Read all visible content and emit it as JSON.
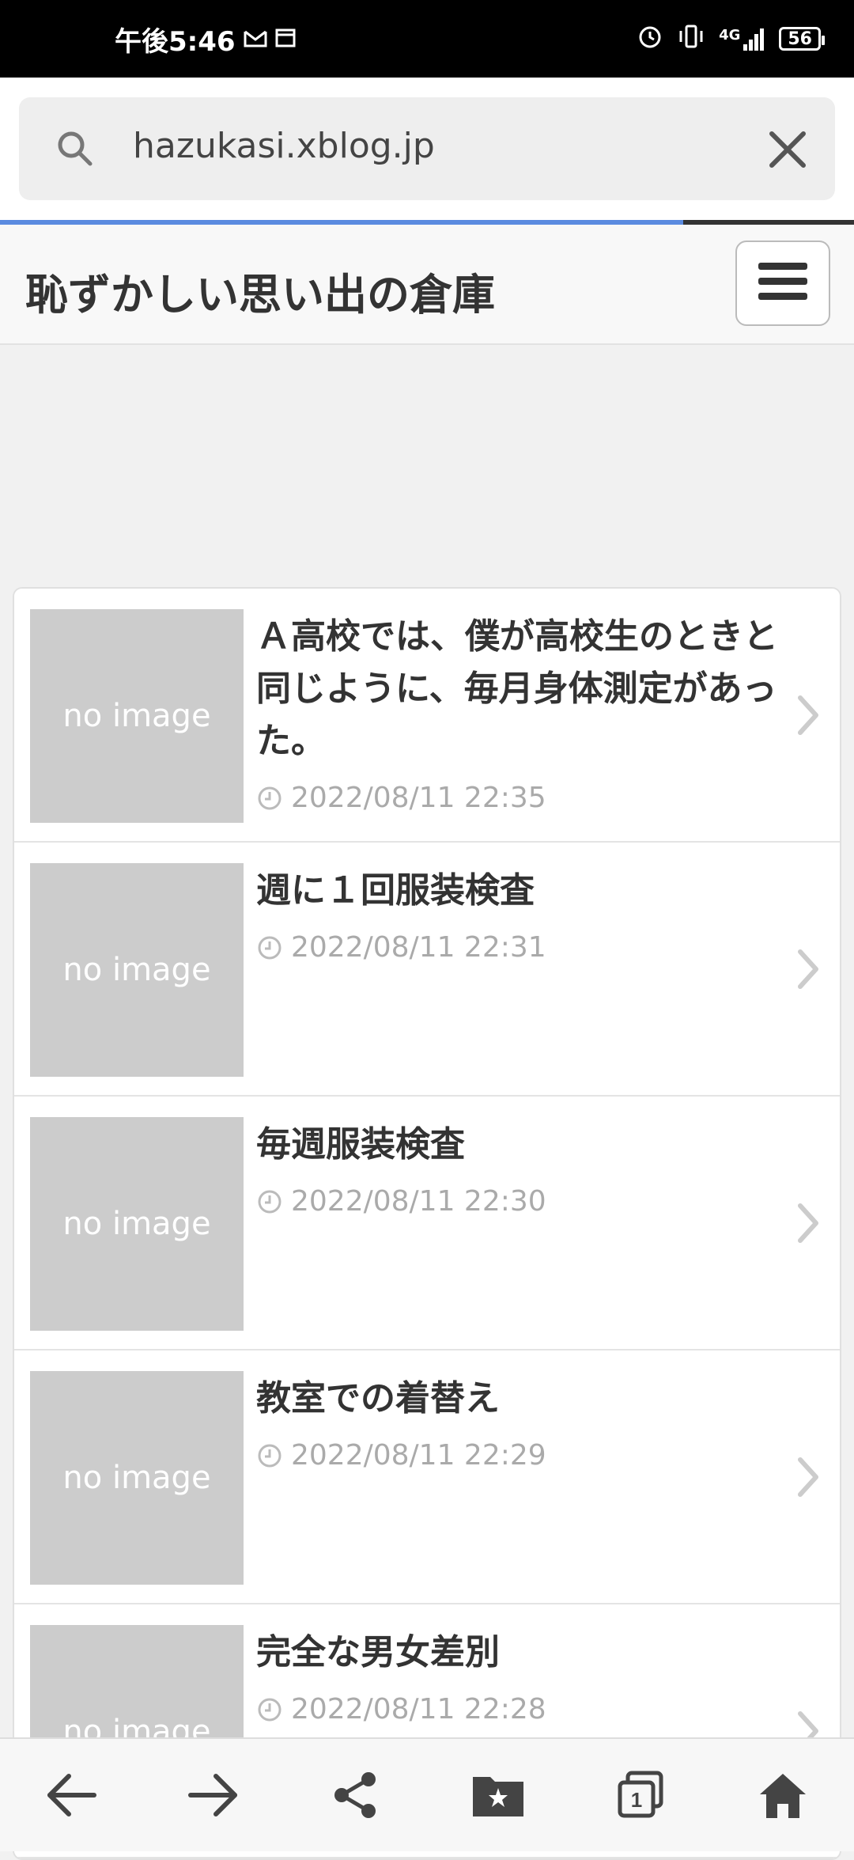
{
  "status_bar": {
    "time": "午後5:46",
    "network": "4G",
    "battery": "56"
  },
  "address_bar": {
    "url": "hazukasi.xblog.jp",
    "progress_percent": 80
  },
  "site": {
    "title": "恥ずかしい思い出の倉庫"
  },
  "articles": [
    {
      "title": "Ａ高校では、僕が高校生のときと同じように、毎月身体測定があった。",
      "date": "2022/08/11 22:35",
      "thumb": "no image"
    },
    {
      "title": "週に１回服装検査",
      "date": "2022/08/11 22:31",
      "thumb": "no image"
    },
    {
      "title": "毎週服装検査",
      "date": "2022/08/11 22:30",
      "thumb": "no image"
    },
    {
      "title": "教室での着替え",
      "date": "2022/08/11 22:29",
      "thumb": "no image"
    },
    {
      "title": "完全な男女差別",
      "date": "2022/08/11 22:28",
      "thumb": "no image"
    }
  ],
  "bottom_nav": {
    "tabs_count": "1"
  },
  "colors": {
    "progress": "#5b8be0",
    "thumb_bg": "#cccccc",
    "accent_text": "#333333"
  }
}
